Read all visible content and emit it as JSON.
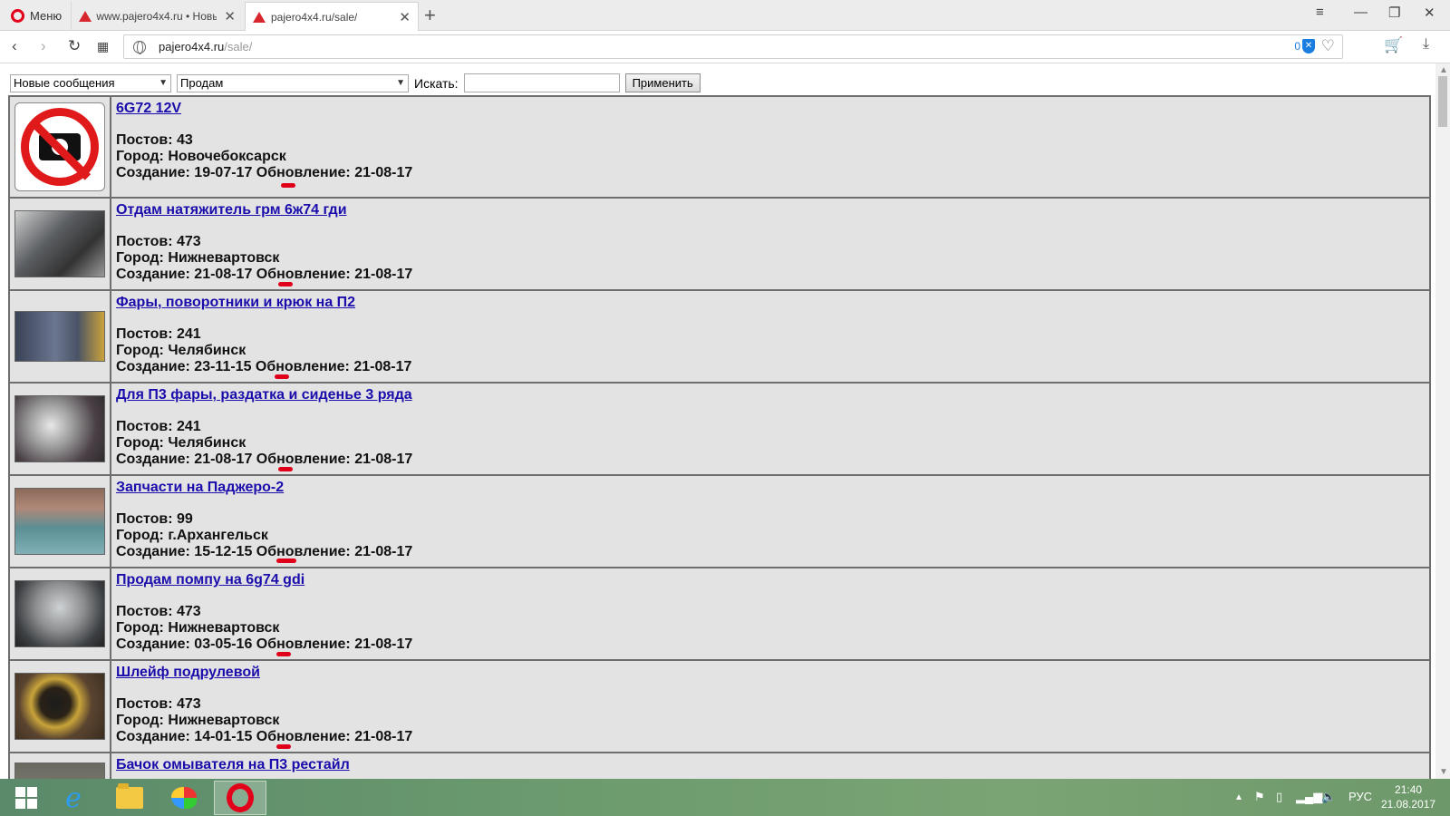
{
  "browser": {
    "menu_label": "Меню",
    "tabs": [
      {
        "title": "www.pajero4x4.ru • Новые",
        "active": false
      },
      {
        "title": "pajero4x4.ru/sale/",
        "active": true
      }
    ],
    "url_host": "pajero4x4.ru",
    "url_path": "/sale/",
    "adblock_count": "0"
  },
  "filters": {
    "category_selected": "Новые сообщения",
    "type_selected": "Продам",
    "search_label": "Искать:",
    "search_value": "",
    "apply_label": "Применить"
  },
  "listings": [
    {
      "title": "6G72 12V",
      "posts": "Постов: 43",
      "city": "Город: Новочебоксарск",
      "dates": "Создание: 19-07-17 Обновление: 21-08-17",
      "thumb": "no-photo"
    },
    {
      "title": "Отдам натяжитель грм 6ж74 гди",
      "posts": "Постов: 473",
      "city": "Город: Нижневартовск",
      "dates": "Создание: 21-08-17 Обновление: 21-08-17",
      "thumb": "#5b5e62"
    },
    {
      "title": "Фары, поворотники и крюк на П2",
      "posts": "Постов: 241",
      "city": "Город: Челябинск",
      "dates": "Создание: 23-11-15 Обновление: 21-08-17",
      "thumb": "#5a6478"
    },
    {
      "title": "Для П3 фары, раздатка и сиденье 3 ряда",
      "posts": "Постов: 241",
      "city": "Город: Челябинск",
      "dates": "Создание: 21-08-17 Обновление: 21-08-17",
      "thumb": "#6c6a6c"
    },
    {
      "title": "Запчасти на Паджеро-2",
      "posts": "Постов: 99",
      "city": "Город: г.Архангельск",
      "dates": "Создание: 15-12-15 Обновление: 21-08-17",
      "thumb": "#5b8f95"
    },
    {
      "title": "Продам помпу на 6g74 gdi",
      "posts": "Постов: 473",
      "city": "Город: Нижневартовск",
      "dates": "Создание: 03-05-16 Обновление: 21-08-17",
      "thumb": "#8d8f90"
    },
    {
      "title": "Шлейф подрулевой",
      "posts": "Постов: 473",
      "city": "Город: Нижневартовск",
      "dates": "Создание: 14-01-15 Обновление: 21-08-17",
      "thumb": "#4a3a28"
    },
    {
      "title": "Бачок омывателя на П3 рестайл",
      "posts": "",
      "city": "",
      "dates": "",
      "thumb": "#777"
    }
  ],
  "taskbar": {
    "language": "РУС",
    "time": "21:40",
    "date": "21.08.2017"
  },
  "colors": {
    "link": "#1a0dab",
    "marker": "#e0001a",
    "row_bg": "#e3e3e3"
  }
}
